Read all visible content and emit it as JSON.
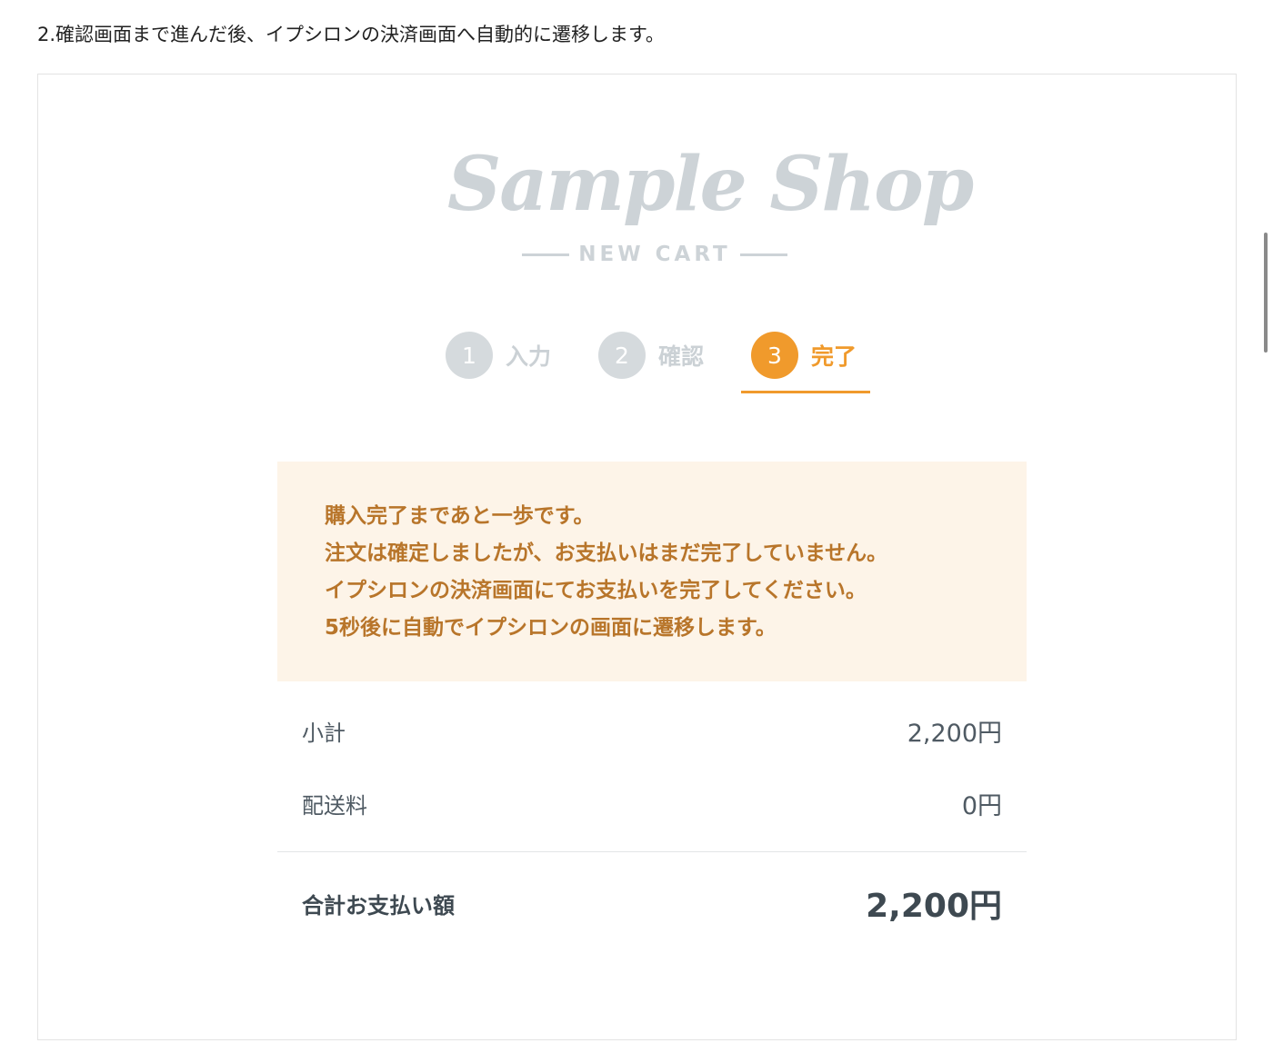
{
  "intro": "2.確認画面まで進んだ後、イプシロンの決済画面へ自動的に遷移します。",
  "logo": {
    "script_text": "Sample Shop",
    "subtitle": "NEW CART"
  },
  "steps": [
    {
      "number": "1",
      "label": "入力",
      "active": false
    },
    {
      "number": "2",
      "label": "確認",
      "active": false
    },
    {
      "number": "3",
      "label": "完了",
      "active": true
    }
  ],
  "notice": {
    "lines": [
      "購入完了まであと一歩です。",
      "注文は確定しましたが、お支払いはまだ完了していません。",
      "イプシロンの決済画面にてお支払いを完了してください。",
      "5秒後に自動でイプシロンの画面に遷移します。"
    ]
  },
  "summary": {
    "subtotal_label": "小計",
    "subtotal_value": "2,200円",
    "shipping_label": "配送料",
    "shipping_value": "0円",
    "total_label": "合計お支払い額",
    "total_value": "2,200円"
  },
  "colors": {
    "accent": "#f09a2c",
    "inactive": "#d5dadd",
    "notice_bg": "#fdf4e8",
    "notice_text": "#b8752a"
  }
}
